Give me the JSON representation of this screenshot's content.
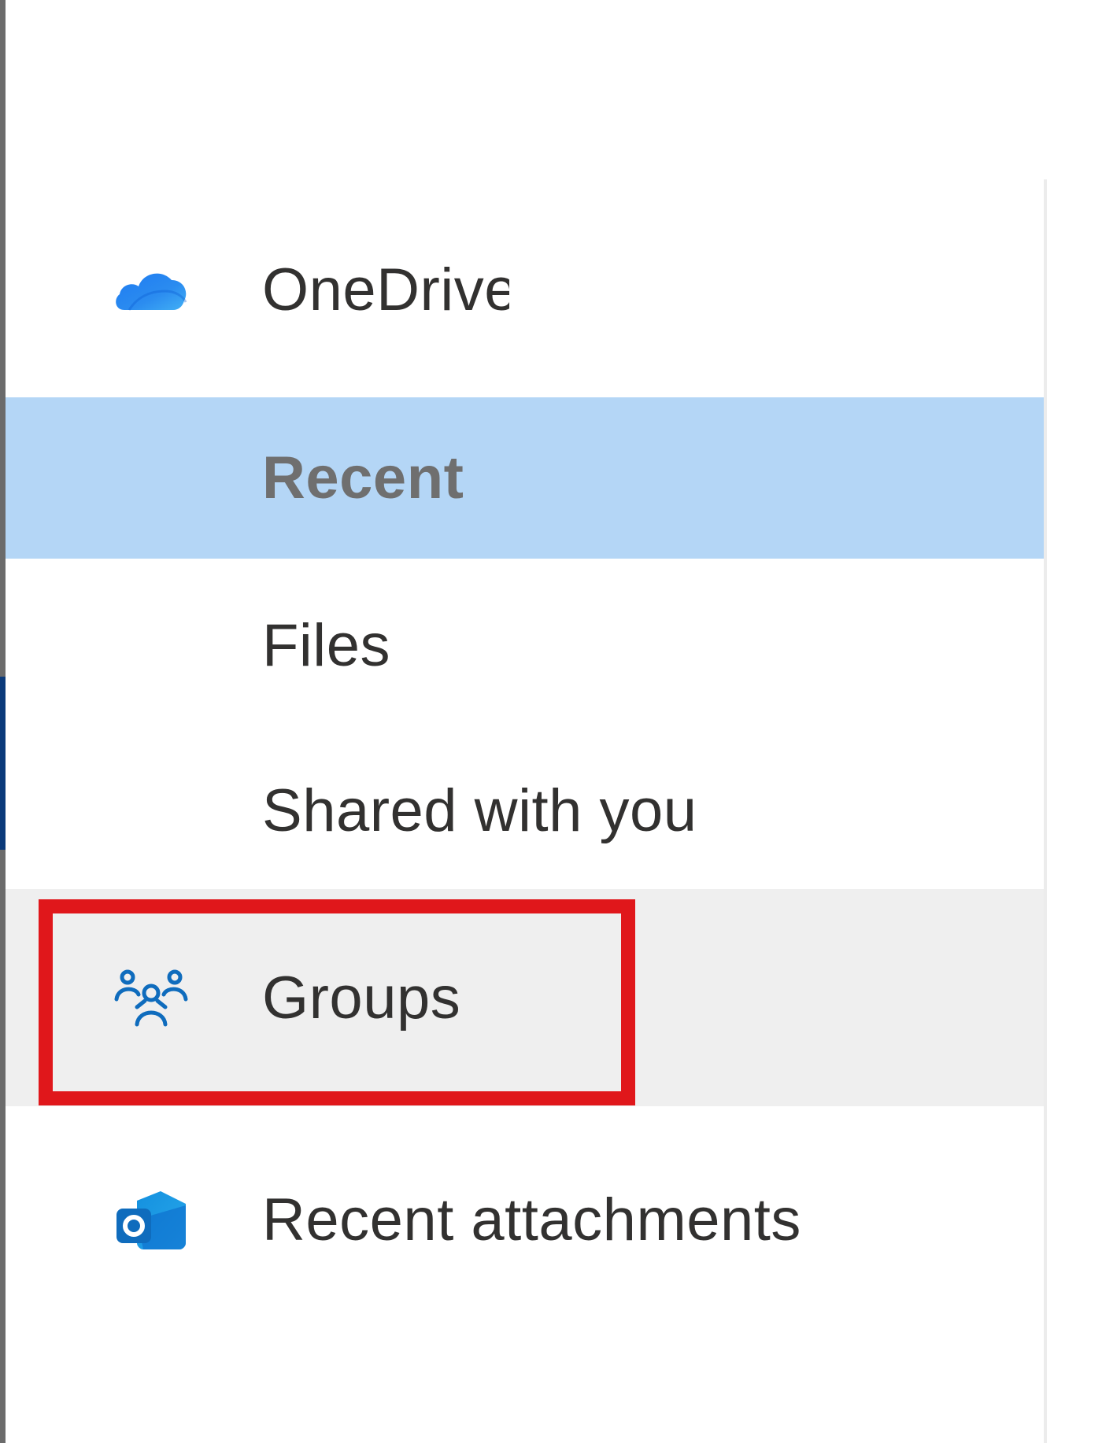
{
  "nav": {
    "items": [
      {
        "label": "OneDrive",
        "icon": "onedrive-cloud-icon",
        "selected": false
      },
      {
        "label": "Recent",
        "icon": "",
        "selected": true
      },
      {
        "label": "Files",
        "icon": "",
        "selected": false
      },
      {
        "label": "Shared with you",
        "icon": "",
        "selected": false
      },
      {
        "label": "Groups",
        "icon": "groups-people-icon",
        "selected": false,
        "hovered": true
      },
      {
        "label": "Recent attachments",
        "icon": "outlook-icon",
        "selected": false
      }
    ]
  },
  "colors": {
    "selected_background": "#b4d6f6",
    "hover_background": "#efefef",
    "highlight_border": "#e0171b",
    "icon_blue": "#0f6cbd",
    "text": "#323130"
  }
}
